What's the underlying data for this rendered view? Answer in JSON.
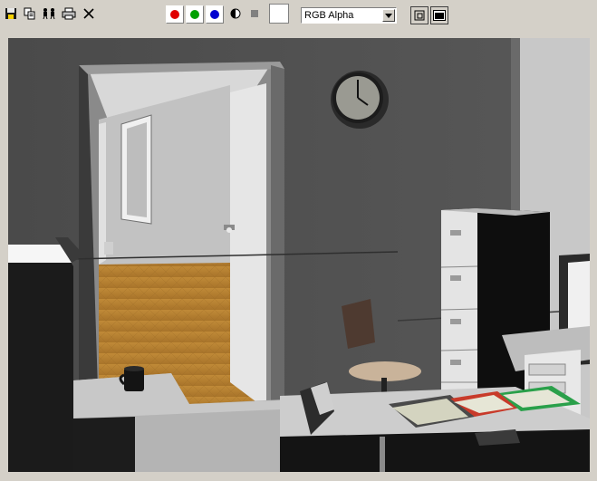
{
  "toolbar": {
    "tools": [
      {
        "name": "save-image",
        "icon": "save-icon"
      },
      {
        "name": "copy-image",
        "icon": "copy-icon"
      },
      {
        "name": "clone-window",
        "icon": "clone-icon"
      },
      {
        "name": "print-image",
        "icon": "print-icon"
      },
      {
        "name": "clear-image",
        "icon": "close-icon"
      }
    ],
    "channels": [
      {
        "name": "red",
        "color": "#e00000"
      },
      {
        "name": "green",
        "color": "#00a000"
      },
      {
        "name": "blue",
        "color": "#0000d0"
      }
    ],
    "swatch_color": "#ffffff",
    "channel_select": {
      "selected": "RGB Alpha"
    }
  },
  "viewport": {
    "clock_time": "9:29"
  }
}
